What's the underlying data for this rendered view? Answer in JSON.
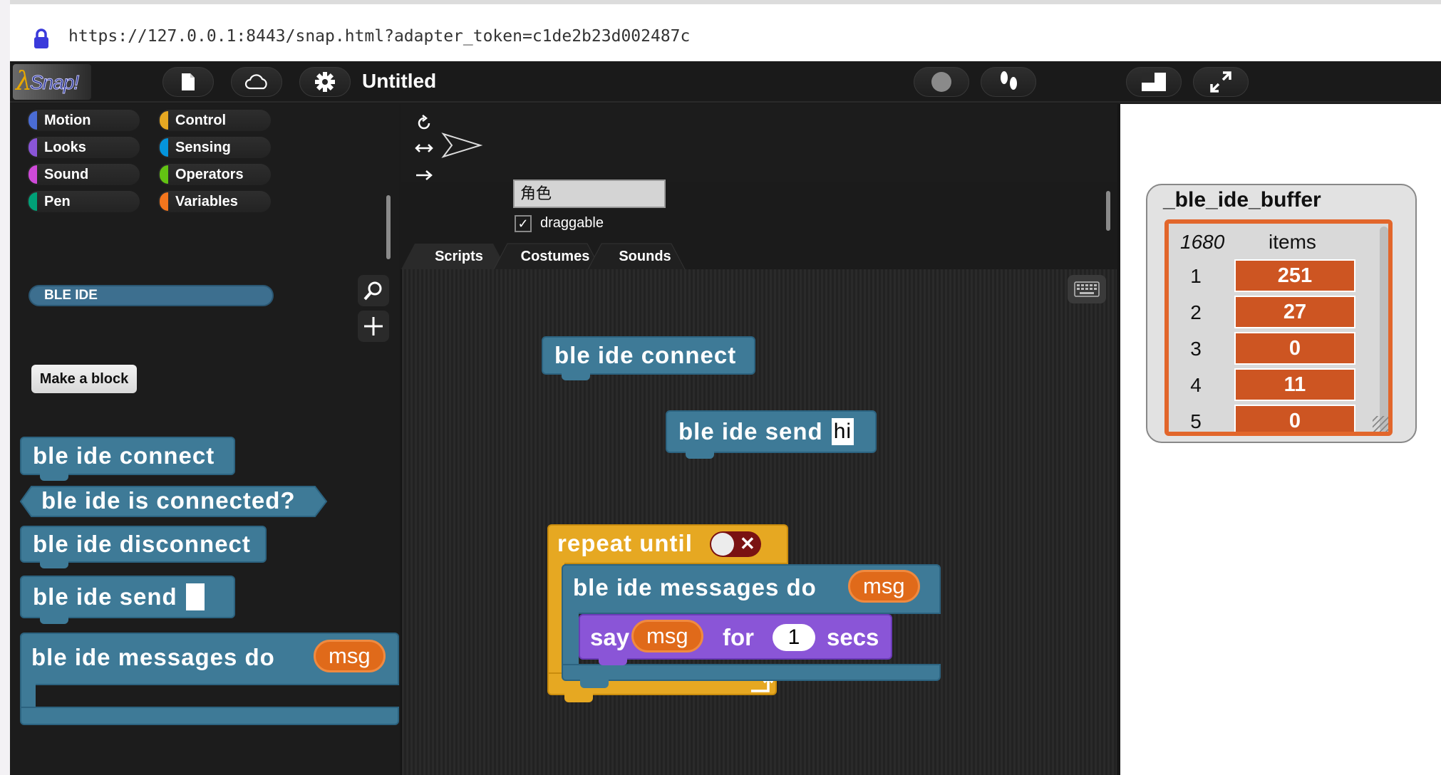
{
  "browser": {
    "url": "https://127.0.0.1:8443/snap.html?adapter_token=c1de2b23d002487c"
  },
  "topbar": {
    "logo_text": "Snap!",
    "project_title": "Untitled"
  },
  "palette": {
    "categories": [
      {
        "label": "Motion",
        "color": "#4a6cd4"
      },
      {
        "label": "Control",
        "color": "#e6a822"
      },
      {
        "label": "Looks",
        "color": "#8a55d7"
      },
      {
        "label": "Sensing",
        "color": "#0494dc"
      },
      {
        "label": "Sound",
        "color": "#cf4ad9"
      },
      {
        "label": "Operators",
        "color": "#62c213"
      },
      {
        "label": "Pen",
        "color": "#00a178"
      },
      {
        "label": "Variables",
        "color": "#f3761d"
      }
    ],
    "custom_category": "BLE IDE",
    "make_block_label": "Make a block",
    "blocks": {
      "connect": "ble ide connect",
      "is_connected": "ble ide is connected?",
      "disconnect": "ble ide disconnect",
      "send": "ble ide send",
      "messages_do": "ble ide messages do",
      "msg_var": "msg"
    }
  },
  "sprite": {
    "name": "角色",
    "draggable_label": "draggable",
    "draggable_checked": "✓"
  },
  "tabs": [
    "Scripts",
    "Costumes",
    "Sounds"
  ],
  "scripts": {
    "connect": "ble ide connect",
    "send": "ble ide send",
    "send_arg": "hi",
    "repeat_until": "repeat until",
    "messages_do": "ble ide messages do",
    "msg_var": "msg",
    "say": "say",
    "for": "for",
    "secs_value": "1",
    "secs": "secs"
  },
  "watcher": {
    "title": "_ble_ide_buffer",
    "length": "1680",
    "items_label": "items",
    "rows": [
      {
        "index": "1",
        "value": "251"
      },
      {
        "index": "2",
        "value": "27"
      },
      {
        "index": "3",
        "value": "0"
      },
      {
        "index": "4",
        "value": "11"
      },
      {
        "index": "5",
        "value": "0"
      }
    ]
  }
}
